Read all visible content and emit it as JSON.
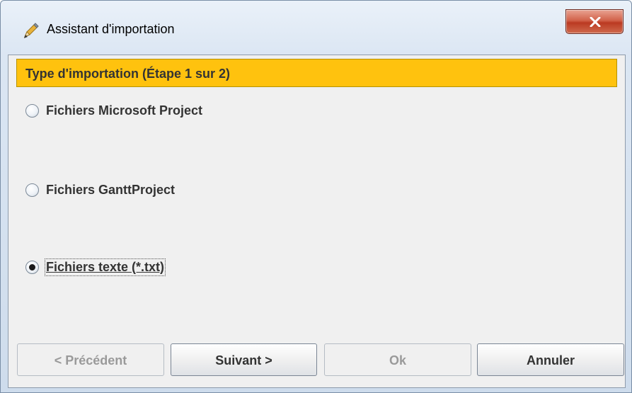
{
  "window": {
    "title": "Assistant d'importation",
    "close_label": "X"
  },
  "step_header": {
    "text": "Type d'importation (Étape 1 sur 2)"
  },
  "options": [
    {
      "label": "Fichiers Microsoft Project",
      "checked": false
    },
    {
      "label": "Fichiers GanttProject",
      "checked": false
    },
    {
      "label": "Fichiers texte (*.txt)",
      "checked": true
    }
  ],
  "buttons": {
    "previous": {
      "label": "< Précédent",
      "enabled": false
    },
    "next": {
      "label": "Suivant >",
      "enabled": true
    },
    "ok": {
      "label": "Ok",
      "enabled": false
    },
    "cancel": {
      "label": "Annuler",
      "enabled": true
    }
  },
  "colors": {
    "header_bg": "#ffc20e",
    "content_bg": "#f0f0f0",
    "close_red": "#c8432b"
  },
  "icons": {
    "app": "pencil-icon",
    "close": "close-icon"
  }
}
